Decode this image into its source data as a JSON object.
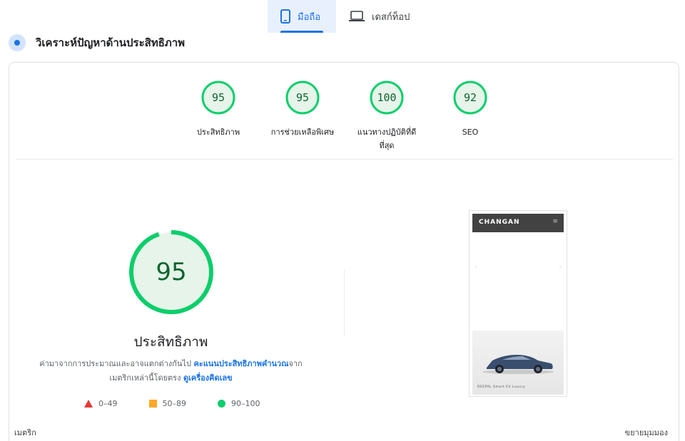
{
  "tabs": [
    {
      "label": "มือถือ",
      "icon": "smartphone-icon",
      "active": true
    },
    {
      "label": "เดสก์ท็อป",
      "icon": "laptop-icon",
      "active": false
    }
  ],
  "section": {
    "title": "วิเคราะห์ปัญหาด้านประสิทธิภาพ",
    "icon": "diagnose-icon"
  },
  "categories": [
    {
      "score": "95",
      "label_line1": "ประสิทธิภาพ",
      "label_line2": ""
    },
    {
      "score": "95",
      "label_line1": "การช่วยเหลือพิเศษ",
      "label_line2": ""
    },
    {
      "score": "100",
      "label_line1": "แนวทางปฏิบัติที่ดี",
      "label_line2": "ที่สุด"
    },
    {
      "score": "92",
      "label_line1": "SEO",
      "label_line2": ""
    }
  ],
  "main": {
    "score": "95",
    "title": "ประสิทธิภาพ",
    "desc_part1": "ค่ามาจากการประมาณและอาจแตกต่างกันไป ",
    "desc_link1": "คะแนนประสิทธิภาพคำนวณ",
    "desc_part2": "จาก",
    "desc_part3": "เมตริกเหล่านี้โดยตรง ",
    "desc_link2": "ดูเครื่องคิดเลข"
  },
  "legend": [
    {
      "range": "0–49",
      "icon": "fail-triangle-icon"
    },
    {
      "range": "50–89",
      "icon": "average-square-icon"
    },
    {
      "range": "90–100",
      "icon": "pass-circle-icon"
    }
  ],
  "preview": {
    "brand": "CHANGAN",
    "menu_glyph": "≡",
    "arrow_left": "‹",
    "arrow_right": "›",
    "caption": "DEEPAL Smart EV Luxury"
  },
  "footer": {
    "metrics_label": "เมตริก",
    "expand_label": "ขยายมุมมอง"
  },
  "colors": {
    "accent": "#1a73e8",
    "pass": "#0cce6b",
    "pass_text": "#0d652d",
    "average": "#ffa726",
    "fail": "#e53935"
  }
}
